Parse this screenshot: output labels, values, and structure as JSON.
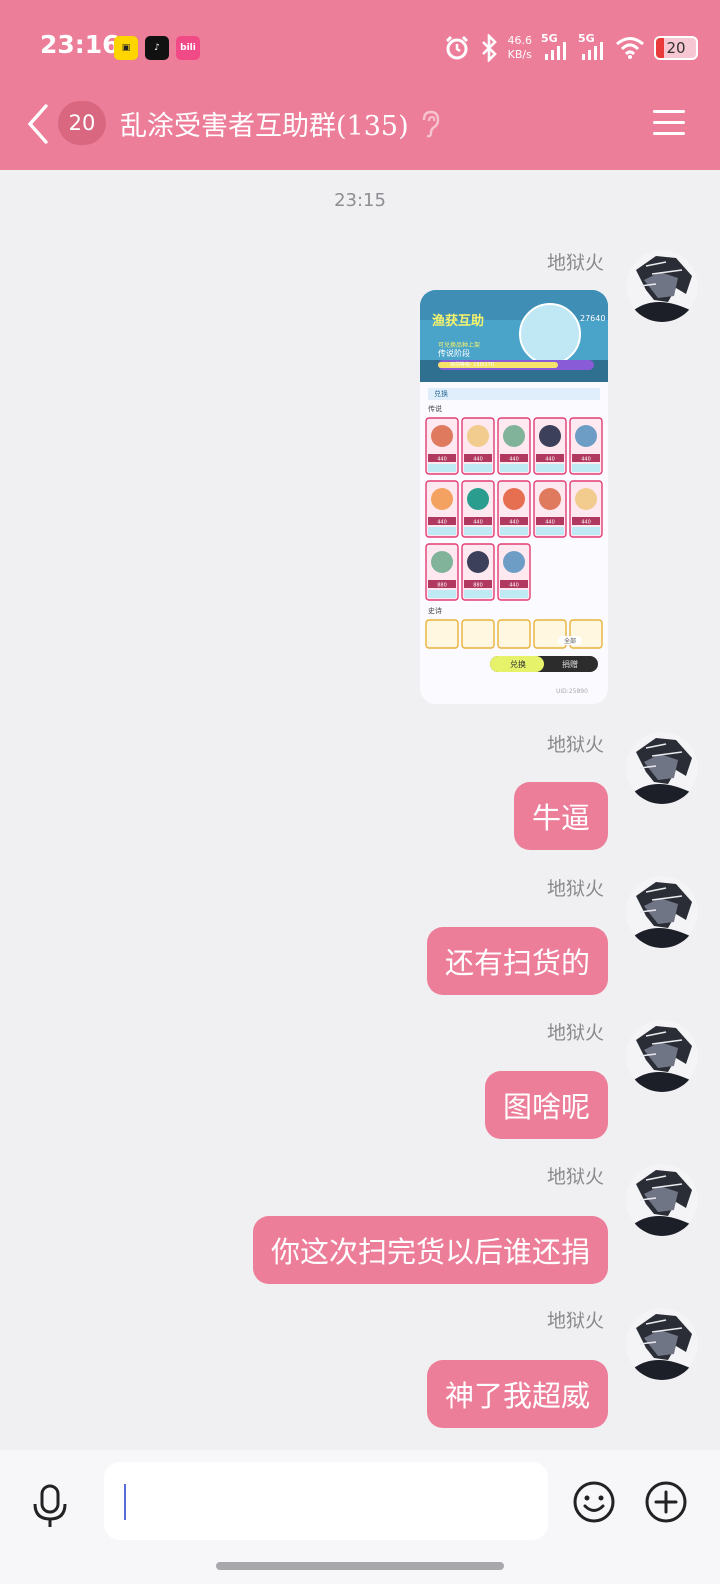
{
  "status_bar": {
    "time": "23:16",
    "apps": [
      "app-a-icon",
      "tiktok-icon",
      "bilibili-icon"
    ],
    "net_speed_value": "46.6",
    "net_speed_unit": "KB/s",
    "sim1": "5G",
    "sim2": "5G",
    "battery": "20"
  },
  "nav": {
    "unread_count": "20",
    "title": "乱涂受害者互助群(135)"
  },
  "chat": {
    "timestamp": "23:15",
    "messages": [
      {
        "sender": "地狱火",
        "type": "image"
      },
      {
        "sender": "地狱火",
        "text": "牛逼"
      },
      {
        "sender": "地狱火",
        "text": "还有扫货的"
      },
      {
        "sender": "地狱火",
        "text": "图啥呢"
      },
      {
        "sender": "地狱火",
        "text": "你这次扫完货以后谁还捐"
      },
      {
        "sender": "地狱火",
        "text": "神了我超威"
      }
    ]
  },
  "screenshot_content": {
    "title": "渔获互助",
    "coins": "27640",
    "stage_label": "可兑换品种上架",
    "stage": "传说阶段",
    "progress": "目前等级: 150/170",
    "tab": "兑换",
    "section1": "传说",
    "section2": "史诗",
    "price_a": "440",
    "price_b": "880",
    "btn_exchange": "兑换",
    "btn_other": "捐赠",
    "filter": "全部",
    "uid": "UID:25890"
  },
  "colors": {
    "accent": "#ed7e9a",
    "background": "#f0f0f3"
  }
}
